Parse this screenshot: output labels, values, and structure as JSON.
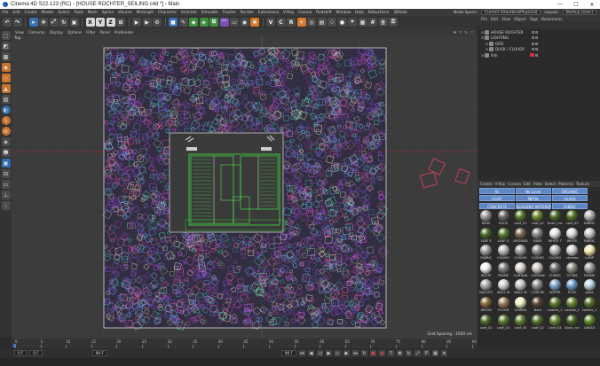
{
  "window": {
    "title": "Cinema 4D S22.123 (RC) - [HOUSE ROCHTER_SEILING.c4d *] - Main",
    "controls": [
      "—",
      "☐",
      "✕"
    ]
  },
  "menubar": {
    "items": [
      "File",
      "Edit",
      "Create",
      "Modes",
      "Select",
      "Tools",
      "Mesh",
      "Spline",
      "Volume",
      "MoGraph",
      "Character",
      "Animate",
      "Simulate",
      "Tracker",
      "Render",
      "Extensions",
      "V-Ray",
      "Corona",
      "Redshift",
      "Window",
      "Help",
      "RebusFarm",
      "3DRabi"
    ],
    "node_space_label": "Node Space:",
    "node_space_value": "Current (Standard/Physical)",
    "layout_label": "Layout:",
    "layout_value": "Startup (User)"
  },
  "toolbar": {
    "axis_x": "X",
    "axis_y": "Y",
    "axis_z": "Z"
  },
  "viewport": {
    "menu": [
      "View",
      "Cameras",
      "Display",
      "Options",
      "Filter",
      "Panel",
      "ProRender"
    ],
    "label": "Top",
    "grid_spacing": "Grid Spacing : 1000 cm"
  },
  "timeline": {
    "ticks": [
      "0",
      "5",
      "10",
      "15",
      "20",
      "25",
      "30",
      "35",
      "40",
      "45",
      "50",
      "55",
      "60",
      "65",
      "70",
      "75",
      "80",
      "85",
      "90"
    ],
    "start_field": "0 F",
    "current_field": "0 F",
    "end_field": "90 F",
    "end_field2": "90 F"
  },
  "object_manager": {
    "menu": [
      "File",
      "Edit",
      "View",
      "Object",
      "Tags",
      "Bookmarks"
    ],
    "rows": [
      {
        "name": "HOUSE ROCHTER",
        "depth": 0
      },
      {
        "name": "LIGHTING",
        "depth": 0
      },
      {
        "name": "GRD",
        "depth": 1
      },
      {
        "name": "DUSK / CLOUDY",
        "depth": 1
      },
      {
        "name": "fish",
        "depth": 0
      }
    ]
  },
  "material_manager": {
    "menu": [
      "Create",
      "V-Ray",
      "Corona",
      "Edit",
      "View",
      "Select",
      "Material",
      "Texture"
    ],
    "layers": [
      "All",
      "No Layer",
      "ORGANIC",
      "LIGHT",
      "METAL",
      "GLASS",
      "CONCRETE",
      "BUILDING MATERIALS",
      "FABRIC"
    ],
    "materials": [
      {
        "label": "BASE",
        "color": "#9a9a9a"
      },
      {
        "label": "ROCK",
        "color": "#6b6b6b"
      },
      {
        "label": "Leaf_01",
        "color": "#5a7a2a"
      },
      {
        "label": "Leaf_01",
        "color": "#6d8a33"
      },
      {
        "label": "Bush_cur",
        "color": "#4c6a2a"
      },
      {
        "label": "Leaf_02",
        "color": "#55752d"
      },
      {
        "label": "FABRIC",
        "color": "#b0b0b0"
      },
      {
        "label": "LEAF E",
        "color": "#4f6b2c"
      },
      {
        "label": "LEAF G",
        "color": "#5f7d33"
      },
      {
        "label": "GROUND",
        "color": "#7a6a50"
      },
      {
        "label": "BASE",
        "color": "#8a8a8a"
      },
      {
        "label": "WHITE T",
        "color": "#e4e4e4"
      },
      {
        "label": "WHITE",
        "color": "#dcdcdc"
      },
      {
        "label": "FABRIC",
        "color": "#c8c8c8"
      },
      {
        "label": "FABRIC",
        "color": "#a0a0a0"
      },
      {
        "label": "CUSHIO",
        "color": "#bdbdbd"
      },
      {
        "label": "CUSHIO",
        "color": "#9e9e9e"
      },
      {
        "label": "CUSHIO",
        "color": "#8c8c8c"
      },
      {
        "label": "CUSHIO",
        "color": "#b8b8b8"
      },
      {
        "label": "chrome",
        "color": "#d0d0d0"
      },
      {
        "label": "LAMP",
        "color": "#f4e9b0"
      },
      {
        "label": "WHITE",
        "color": "#efefef"
      },
      {
        "label": "FRAME",
        "color": "#7d7d7d"
      },
      {
        "label": "CURTAIN",
        "color": "#d8d4cc"
      },
      {
        "label": "CURTAIN",
        "color": "#cac6be"
      },
      {
        "label": "CHAIRC",
        "color": "#6a6a6a"
      },
      {
        "label": "STONE",
        "color": "#8e8a84"
      },
      {
        "label": "FRAME",
        "color": "#9a9a9a"
      },
      {
        "label": "BALUSTI",
        "color": "#a8a8a8"
      },
      {
        "label": "WALL W",
        "color": "#d2d2d2"
      },
      {
        "label": "WALL W",
        "color": "#c4c4c4"
      },
      {
        "label": "CONCRE",
        "color": "#8f8f8f"
      },
      {
        "label": "WATER",
        "color": "#7fa3c4"
      },
      {
        "label": "POOL",
        "color": "#6fa0c8"
      },
      {
        "label": "glass",
        "color": "#bcd4e0"
      },
      {
        "label": "WOOD",
        "color": "#8a6a40"
      },
      {
        "label": "FLOOR",
        "color": "#a08060"
      },
      {
        "label": "LUMINA",
        "color": "#f2f2c0"
      },
      {
        "label": "Bark",
        "color": "#5a4a3a"
      },
      {
        "label": "Leaves_1",
        "color": "#5f7a30"
      },
      {
        "label": "Leaves_1",
        "color": "#6a8535"
      },
      {
        "label": "Leaves_1",
        "color": "#57722c"
      },
      {
        "label": "Leaf_02",
        "color": "#4d6a2b"
      },
      {
        "label": "Leaf_02",
        "color": "#5c7a32"
      },
      {
        "label": "Leaf_03",
        "color": "#647f36"
      },
      {
        "label": "Leaf_02",
        "color": "#58742f"
      },
      {
        "label": "Leaf_03",
        "color": "#6a8838"
      },
      {
        "label": "Bush_cur",
        "color": "#4a662a"
      },
      {
        "label": "GRASS",
        "color": "#5f8a30"
      }
    ]
  },
  "colors": {
    "accent_blue": "#5f86c4",
    "viewport_bg": "#3c3c3c",
    "scatter_magenta": "#c040e0",
    "scatter_cyan": "#40d0e0",
    "house_green": "#40ff40",
    "selection_red": "#e04060"
  }
}
